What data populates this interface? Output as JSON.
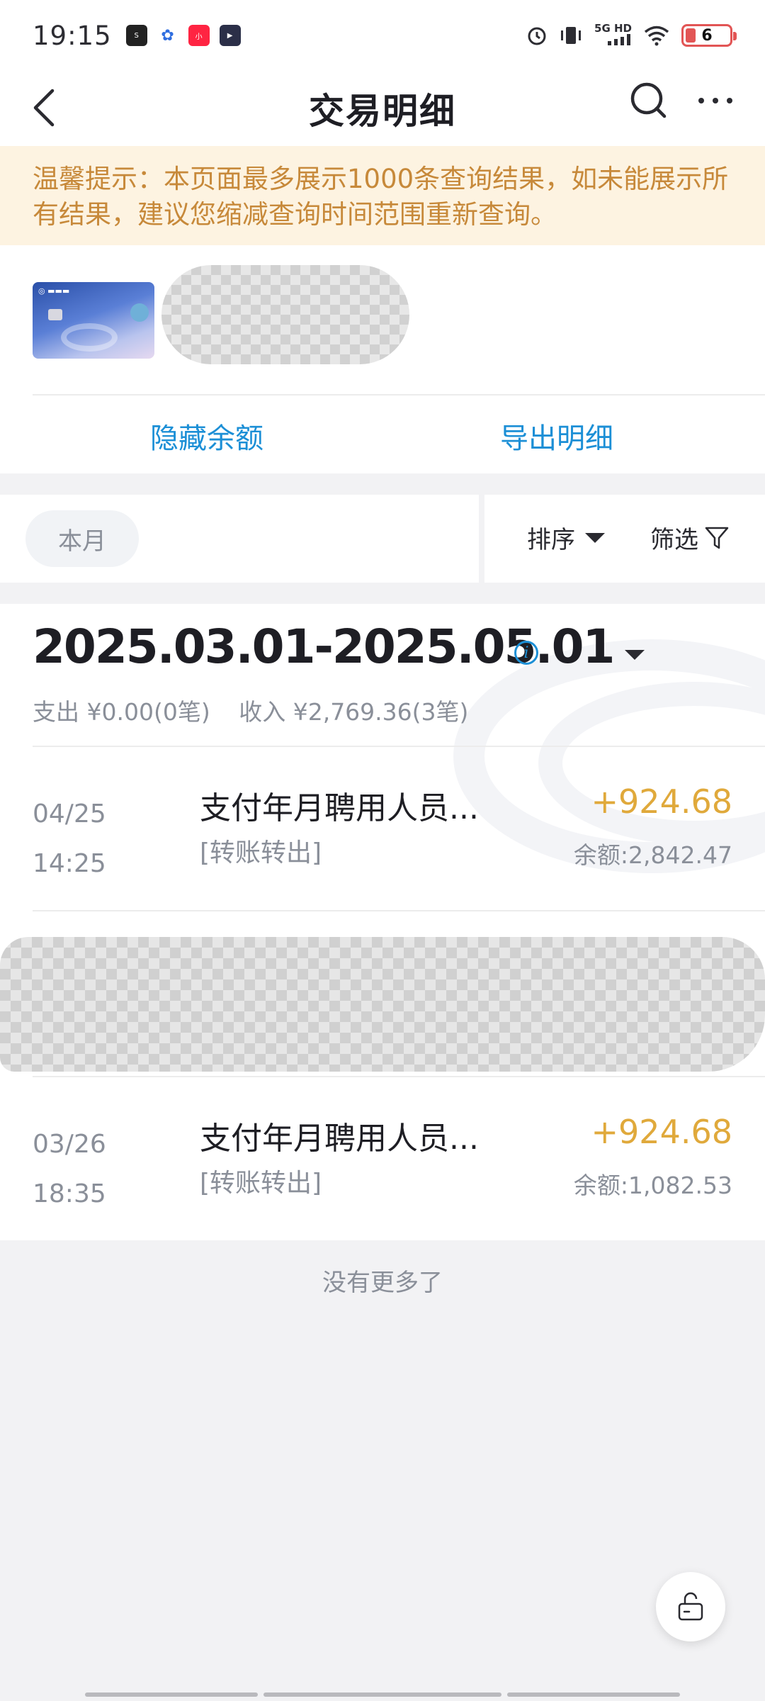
{
  "status_bar": {
    "time": "19:15",
    "network": "5G HD",
    "battery": "6",
    "app_icons": [
      "soul-app-icon",
      "baidu-app-icon",
      "xiaohongshu-app-icon",
      "media-app-icon"
    ]
  },
  "nav": {
    "title": "交易明细",
    "back_icon": "back-icon",
    "search_icon": "search-icon",
    "more_icon": "more-icon"
  },
  "notice": {
    "text": "温馨提示：本页面最多展示1000条查询结果，如未能展示所有结果，建议您缩减查询时间范围重新查询。"
  },
  "card": {
    "hide_balance": "隐藏余额",
    "export": "导出明细"
  },
  "filter": {
    "month_chip": "本月",
    "sort": "排序",
    "filter": "筛选"
  },
  "list": {
    "date_range": "2025.03.01-2025.05.01",
    "summary_expense": "支出 ¥0.00(0笔)",
    "summary_income": "收入 ¥2,769.36(3笔)",
    "transactions": [
      {
        "date": "04/25",
        "time": "14:25",
        "description": "支付年月聘用人员...",
        "type": "[转账转出]",
        "amount": "+924.68",
        "balance": "余额:2,842.47"
      },
      {
        "date": "03/26",
        "time": "18:35",
        "description": "支付年月聘用人员...",
        "type": "[转账转出]",
        "amount": "+924.68",
        "balance": "余额:1,082.53"
      }
    ],
    "end_text": "没有更多了"
  },
  "colors": {
    "accent_blue": "#1c8fd6",
    "amount_gold": "#e0a93b",
    "notice_bg": "#fdf3e1",
    "notice_text": "#c7893a"
  }
}
